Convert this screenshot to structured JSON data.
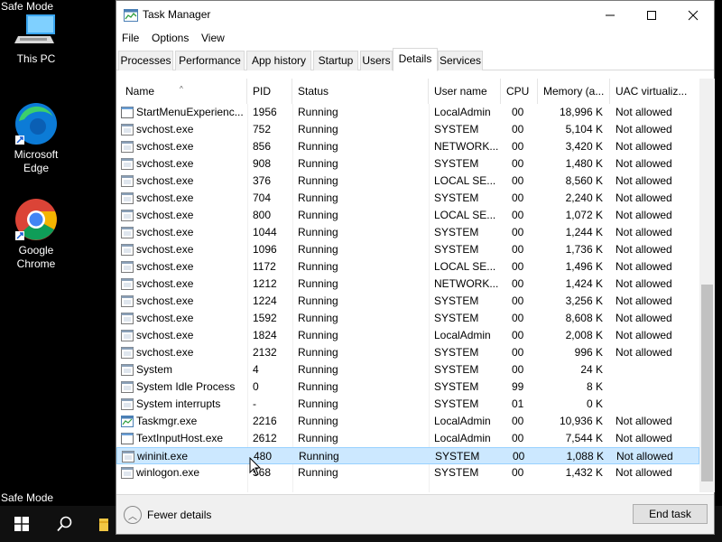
{
  "desktop": {
    "safe_mode_top": "Safe Mode",
    "safe_mode_bottom": "Safe Mode",
    "icons": [
      {
        "label_line1": "This PC",
        "label_line2": ""
      },
      {
        "label_line1": "Microsoft",
        "label_line2": "Edge"
      },
      {
        "label_line1": "Google",
        "label_line2": "Chrome"
      }
    ]
  },
  "window": {
    "title": "Task Manager",
    "menu": [
      "File",
      "Options",
      "View"
    ],
    "tabs": [
      "Processes",
      "Performance",
      "App history",
      "Startup",
      "Users",
      "Details",
      "Services"
    ],
    "active_tab": "Details",
    "columns": [
      "Name",
      "PID",
      "Status",
      "User name",
      "CPU",
      "Memory (a...",
      "UAC virtualiz..."
    ],
    "rows": [
      {
        "name": "StartMenuExperienc...",
        "pid": "1956",
        "status": "Running",
        "user": "LocalAdmin",
        "cpu": "00",
        "mem": "18,996 K",
        "uac": "Not allowed",
        "icon": "app"
      },
      {
        "name": "svchost.exe",
        "pid": "752",
        "status": "Running",
        "user": "SYSTEM",
        "cpu": "00",
        "mem": "5,104 K",
        "uac": "Not allowed",
        "icon": "svc"
      },
      {
        "name": "svchost.exe",
        "pid": "856",
        "status": "Running",
        "user": "NETWORK...",
        "cpu": "00",
        "mem": "3,420 K",
        "uac": "Not allowed",
        "icon": "svc"
      },
      {
        "name": "svchost.exe",
        "pid": "908",
        "status": "Running",
        "user": "SYSTEM",
        "cpu": "00",
        "mem": "1,480 K",
        "uac": "Not allowed",
        "icon": "svc"
      },
      {
        "name": "svchost.exe",
        "pid": "376",
        "status": "Running",
        "user": "LOCAL SE...",
        "cpu": "00",
        "mem": "8,560 K",
        "uac": "Not allowed",
        "icon": "svc"
      },
      {
        "name": "svchost.exe",
        "pid": "704",
        "status": "Running",
        "user": "SYSTEM",
        "cpu": "00",
        "mem": "2,240 K",
        "uac": "Not allowed",
        "icon": "svc"
      },
      {
        "name": "svchost.exe",
        "pid": "800",
        "status": "Running",
        "user": "LOCAL SE...",
        "cpu": "00",
        "mem": "1,072 K",
        "uac": "Not allowed",
        "icon": "svc"
      },
      {
        "name": "svchost.exe",
        "pid": "1044",
        "status": "Running",
        "user": "SYSTEM",
        "cpu": "00",
        "mem": "1,244 K",
        "uac": "Not allowed",
        "icon": "svc"
      },
      {
        "name": "svchost.exe",
        "pid": "1096",
        "status": "Running",
        "user": "SYSTEM",
        "cpu": "00",
        "mem": "1,736 K",
        "uac": "Not allowed",
        "icon": "svc"
      },
      {
        "name": "svchost.exe",
        "pid": "1172",
        "status": "Running",
        "user": "LOCAL SE...",
        "cpu": "00",
        "mem": "1,496 K",
        "uac": "Not allowed",
        "icon": "svc"
      },
      {
        "name": "svchost.exe",
        "pid": "1212",
        "status": "Running",
        "user": "NETWORK...",
        "cpu": "00",
        "mem": "1,424 K",
        "uac": "Not allowed",
        "icon": "svc"
      },
      {
        "name": "svchost.exe",
        "pid": "1224",
        "status": "Running",
        "user": "SYSTEM",
        "cpu": "00",
        "mem": "3,256 K",
        "uac": "Not allowed",
        "icon": "svc"
      },
      {
        "name": "svchost.exe",
        "pid": "1592",
        "status": "Running",
        "user": "SYSTEM",
        "cpu": "00",
        "mem": "8,608 K",
        "uac": "Not allowed",
        "icon": "svc"
      },
      {
        "name": "svchost.exe",
        "pid": "1824",
        "status": "Running",
        "user": "LocalAdmin",
        "cpu": "00",
        "mem": "2,008 K",
        "uac": "Not allowed",
        "icon": "svc"
      },
      {
        "name": "svchost.exe",
        "pid": "2132",
        "status": "Running",
        "user": "SYSTEM",
        "cpu": "00",
        "mem": "996 K",
        "uac": "Not allowed",
        "icon": "svc"
      },
      {
        "name": "System",
        "pid": "4",
        "status": "Running",
        "user": "SYSTEM",
        "cpu": "00",
        "mem": "24 K",
        "uac": "",
        "icon": "svc"
      },
      {
        "name": "System Idle Process",
        "pid": "0",
        "status": "Running",
        "user": "SYSTEM",
        "cpu": "99",
        "mem": "8 K",
        "uac": "",
        "icon": "svc"
      },
      {
        "name": "System interrupts",
        "pid": "-",
        "status": "Running",
        "user": "SYSTEM",
        "cpu": "01",
        "mem": "0 K",
        "uac": "",
        "icon": "svc"
      },
      {
        "name": "Taskmgr.exe",
        "pid": "2216",
        "status": "Running",
        "user": "LocalAdmin",
        "cpu": "00",
        "mem": "10,936 K",
        "uac": "Not allowed",
        "icon": "tm"
      },
      {
        "name": "TextInputHost.exe",
        "pid": "2612",
        "status": "Running",
        "user": "LocalAdmin",
        "cpu": "00",
        "mem": "7,544 K",
        "uac": "Not allowed",
        "icon": "app"
      },
      {
        "name": "wininit.exe",
        "pid": "480",
        "status": "Running",
        "user": "SYSTEM",
        "cpu": "00",
        "mem": "1,088 K",
        "uac": "Not allowed",
        "icon": "svc"
      },
      {
        "name": "winlogon.exe",
        "pid": "568",
        "status": "Running",
        "user": "SYSTEM",
        "cpu": "00",
        "mem": "1,432 K",
        "uac": "Not allowed",
        "icon": "svc"
      }
    ],
    "selected_row_index": 20,
    "footer": {
      "fewer_details": "Fewer details",
      "end_task": "End task"
    }
  },
  "colors": {
    "selection": "#cce8ff",
    "selection_border": "#99d1ff",
    "accent": "#0078d7"
  }
}
